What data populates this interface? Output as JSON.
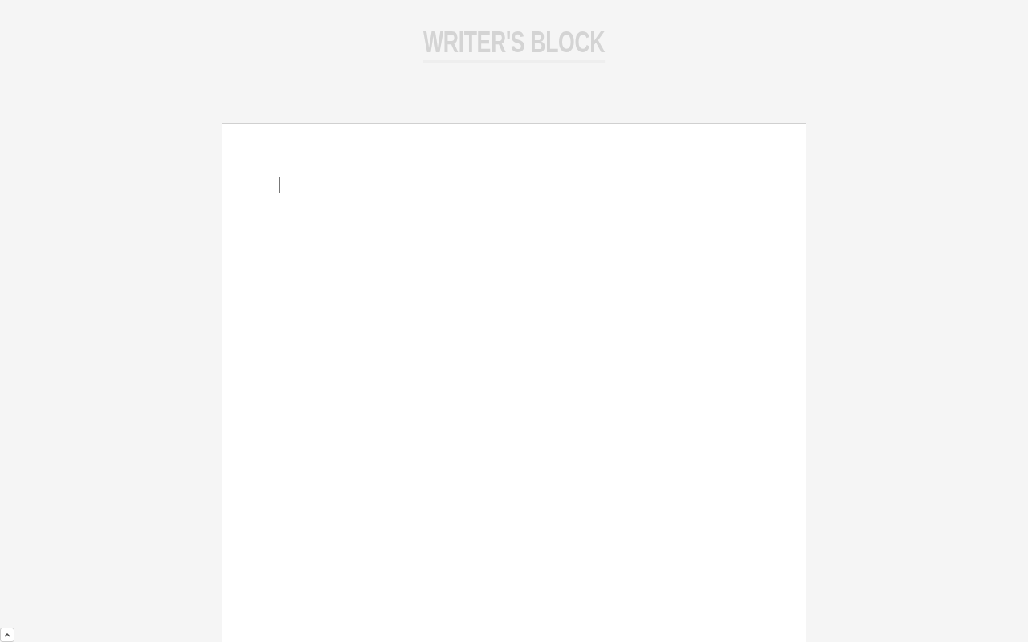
{
  "header": {
    "title": "WRITER'S BLOCK"
  },
  "editor": {
    "focused": true
  }
}
